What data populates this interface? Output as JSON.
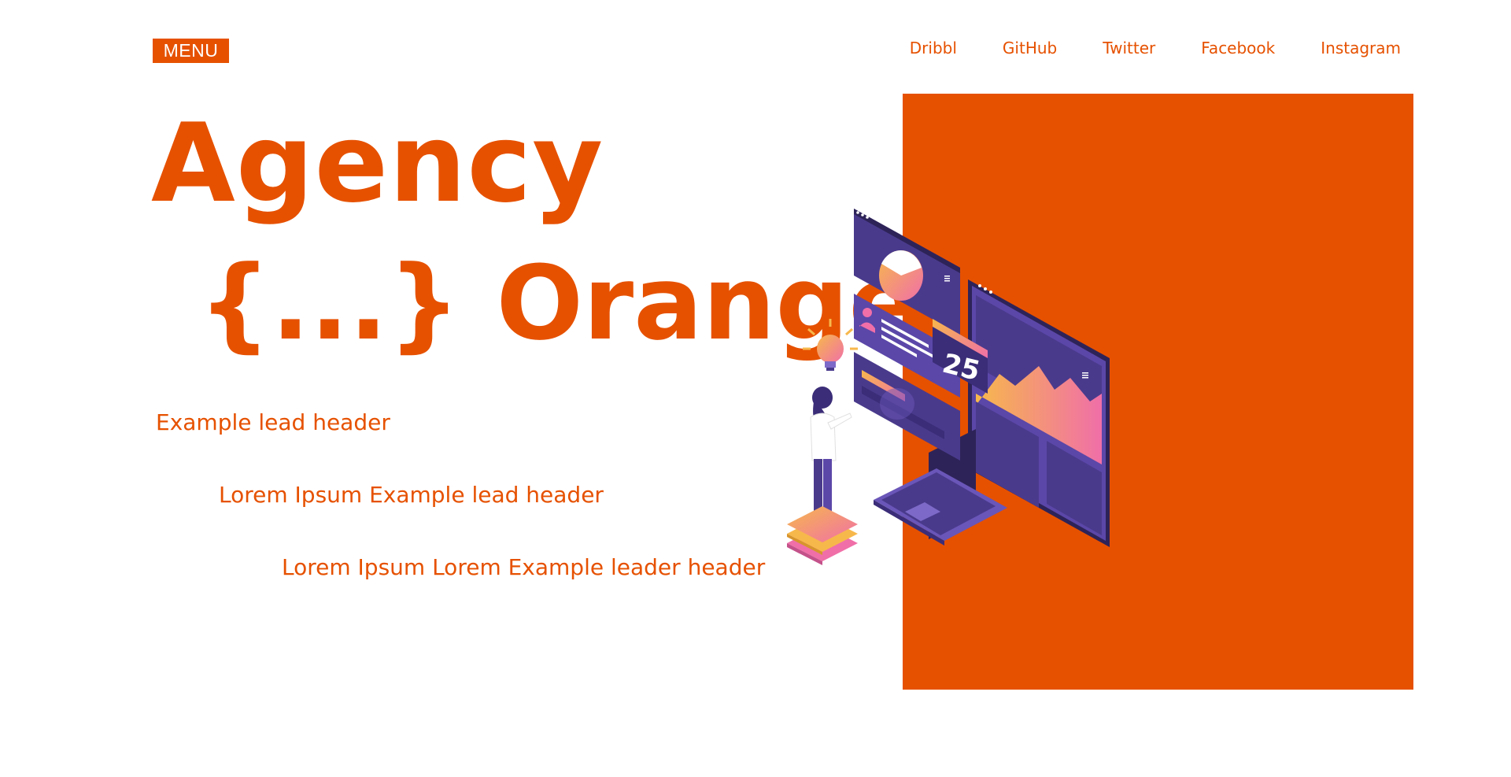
{
  "header": {
    "menu_label": "MENU",
    "social_links": [
      {
        "label": "Dribbl"
      },
      {
        "label": "GitHub"
      },
      {
        "label": "Twitter"
      },
      {
        "label": "Facebook"
      },
      {
        "label": "Instagram"
      }
    ]
  },
  "hero": {
    "title_line1": "Agency",
    "title_line2": "{...} Orange",
    "leads": [
      "Example lead header",
      "Lorem Ipsum Example lead header",
      "Lorem Ipsum Lorem Example leader header"
    ],
    "illustration": {
      "dashboard_number": "25"
    }
  },
  "colors": {
    "accent": "#e65100",
    "illustration_purple": "#4a3a8c",
    "illustration_dark": "#2e2358",
    "gradient_pink": "#f06fa8",
    "gradient_yellow": "#f7b84b"
  },
  "icons": [
    "lightbulb-icon",
    "pie-chart-icon",
    "user-icon",
    "hamburger-icon"
  ]
}
